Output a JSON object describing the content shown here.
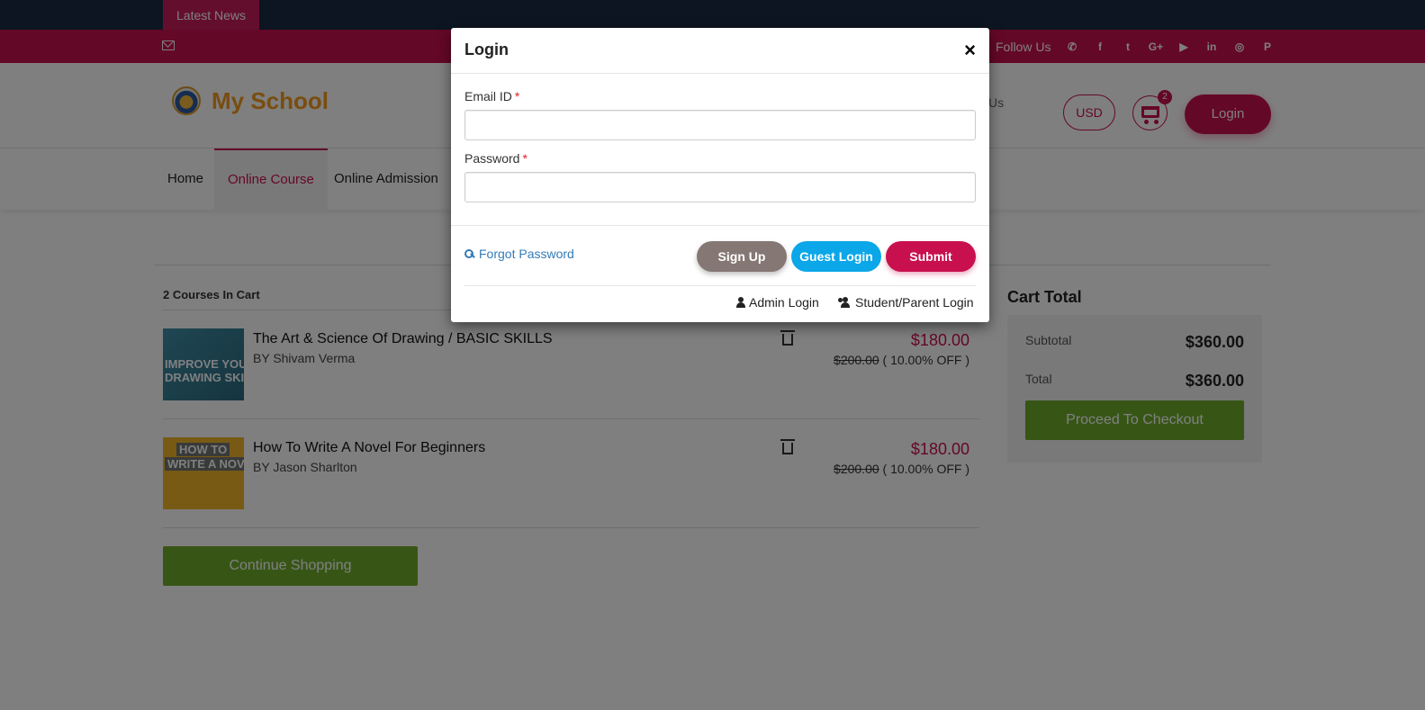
{
  "topbar": {
    "news_label": "Latest News"
  },
  "social": {
    "follow_label": "Follow Us",
    "icons": [
      "whatsapp-icon",
      "facebook-icon",
      "twitter-icon",
      "google-plus-icon",
      "youtube-icon",
      "linkedin-icon",
      "instagram-icon",
      "pinterest-icon"
    ],
    "glyphs": [
      "✆",
      "f",
      "t",
      "G+",
      "▶",
      "in",
      "◎",
      "P"
    ]
  },
  "header": {
    "logo_text": "My School",
    "partial_text": "Us",
    "currency": "USD",
    "cart_count": "2",
    "login_label": "Login"
  },
  "nav": {
    "items": [
      {
        "label": "Home"
      },
      {
        "label": "Online Course"
      },
      {
        "label": "Online Admission"
      }
    ]
  },
  "cart": {
    "courses_title": "2 Courses In Cart",
    "items": [
      {
        "name": "The Art & Science Of Drawing / BASIC SKILLS",
        "by": "BY Shivam Verma",
        "price": "$180.00",
        "old_price": "$200.00",
        "discount": " ( 10.00% OFF )",
        "thumb_text": [
          "IMPROVE YOUR",
          "DRAWING SKILLS"
        ]
      },
      {
        "name": "How To Write A Novel For Beginners",
        "by": "BY Jason Sharlton",
        "price": "$180.00",
        "old_price": "$200.00",
        "discount": " ( 10.00% OFF )",
        "thumb_text": [
          "HOW TO",
          "WRITE A NOVEL"
        ]
      }
    ],
    "continue_label": "Continue Shopping"
  },
  "cart_total": {
    "title": "Cart Total",
    "subtotal_label": "Subtotal",
    "subtotal_value": "$360.00",
    "total_label": "Total",
    "total_value": "$360.00",
    "checkout_label": "Proceed To Checkout"
  },
  "modal": {
    "title": "Login",
    "close": "×",
    "email_label": "Email ID",
    "password_label": "Password",
    "required_mark": "*",
    "email_value": "",
    "password_value": "",
    "forgot_label": "Forgot Password",
    "signup_label": "Sign Up",
    "guest_label": "Guest Login",
    "submit_label": "Submit",
    "admin_login_label": "Admin Login",
    "student_login_label": "Student/Parent Login"
  },
  "colors": {
    "brand": "#c8104f",
    "navy": "#1b2a44",
    "green": "#6fac2d",
    "guest_blue": "#0ba7e8",
    "signup_gray": "#857773"
  }
}
